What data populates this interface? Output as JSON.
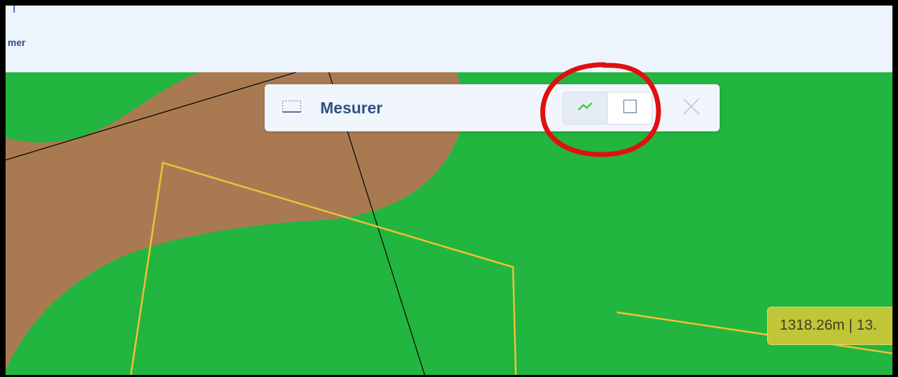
{
  "header": {
    "glyph": "ᒣ",
    "label": "mer"
  },
  "measure_panel": {
    "title": "Mesurer",
    "icon": "ruler-icon",
    "buttons": [
      {
        "name": "measure-line-button",
        "icon": "polyline-icon",
        "active": true
      },
      {
        "name": "measure-area-button",
        "icon": "dotted-square-icon",
        "active": false
      }
    ],
    "close_icon": "close-icon"
  },
  "measurement_tooltip": {
    "text": "1318.26m | 13."
  },
  "colors": {
    "map_background": "#22b53f",
    "land_patch": "#a97a52",
    "measured_line": "#f2c037",
    "boundary_line": "#000000",
    "tooltip_bg": "#c1c639",
    "active_icon": "#33cc33",
    "annotation_circle": "#e01010"
  }
}
